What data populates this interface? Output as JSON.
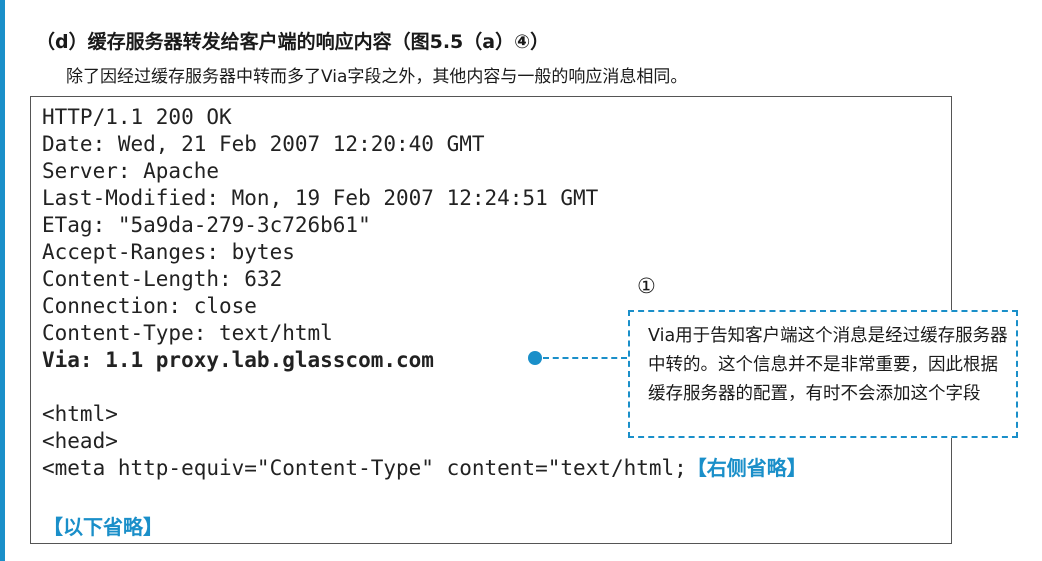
{
  "section": {
    "heading": "（d）缓存服务器转发给客户端的响应内容（图5.5（a）④）",
    "description": "除了因经过缓存服务器中转而多了Via字段之外，其他内容与一般的响应消息相同。"
  },
  "code": {
    "lines": [
      "HTTP/1.1 200 OK",
      "Date: Wed, 21 Feb 2007 12:20:40 GMT",
      "Server: Apache",
      "Last-Modified: Mon, 19 Feb 2007 12:24:51 GMT",
      "ETag: \"5a9da-279-3c726b61\"",
      "Accept-Ranges: bytes",
      "Content-Length: 632",
      "Connection: close",
      "Content-Type: text/html",
      "Via: 1.1 proxy.lab.glasscom.com",
      "",
      "<html>",
      "<head>",
      "<meta http-equiv=\"Content-Type\" content=\"text/html;"
    ],
    "right_omitted": "【右侧省略】",
    "below_omitted": "【以下省略】"
  },
  "callout": {
    "number": "①",
    "text": "Via用于告知客户端这个消息是经过缓存服务器中转的。这个信息并不是非常重要，因此根据缓存服务器的配置，有时不会添加这个字段"
  },
  "colors": {
    "accent": "#1a8fc9",
    "text": "#1a1a1a",
    "border": "#555555"
  }
}
